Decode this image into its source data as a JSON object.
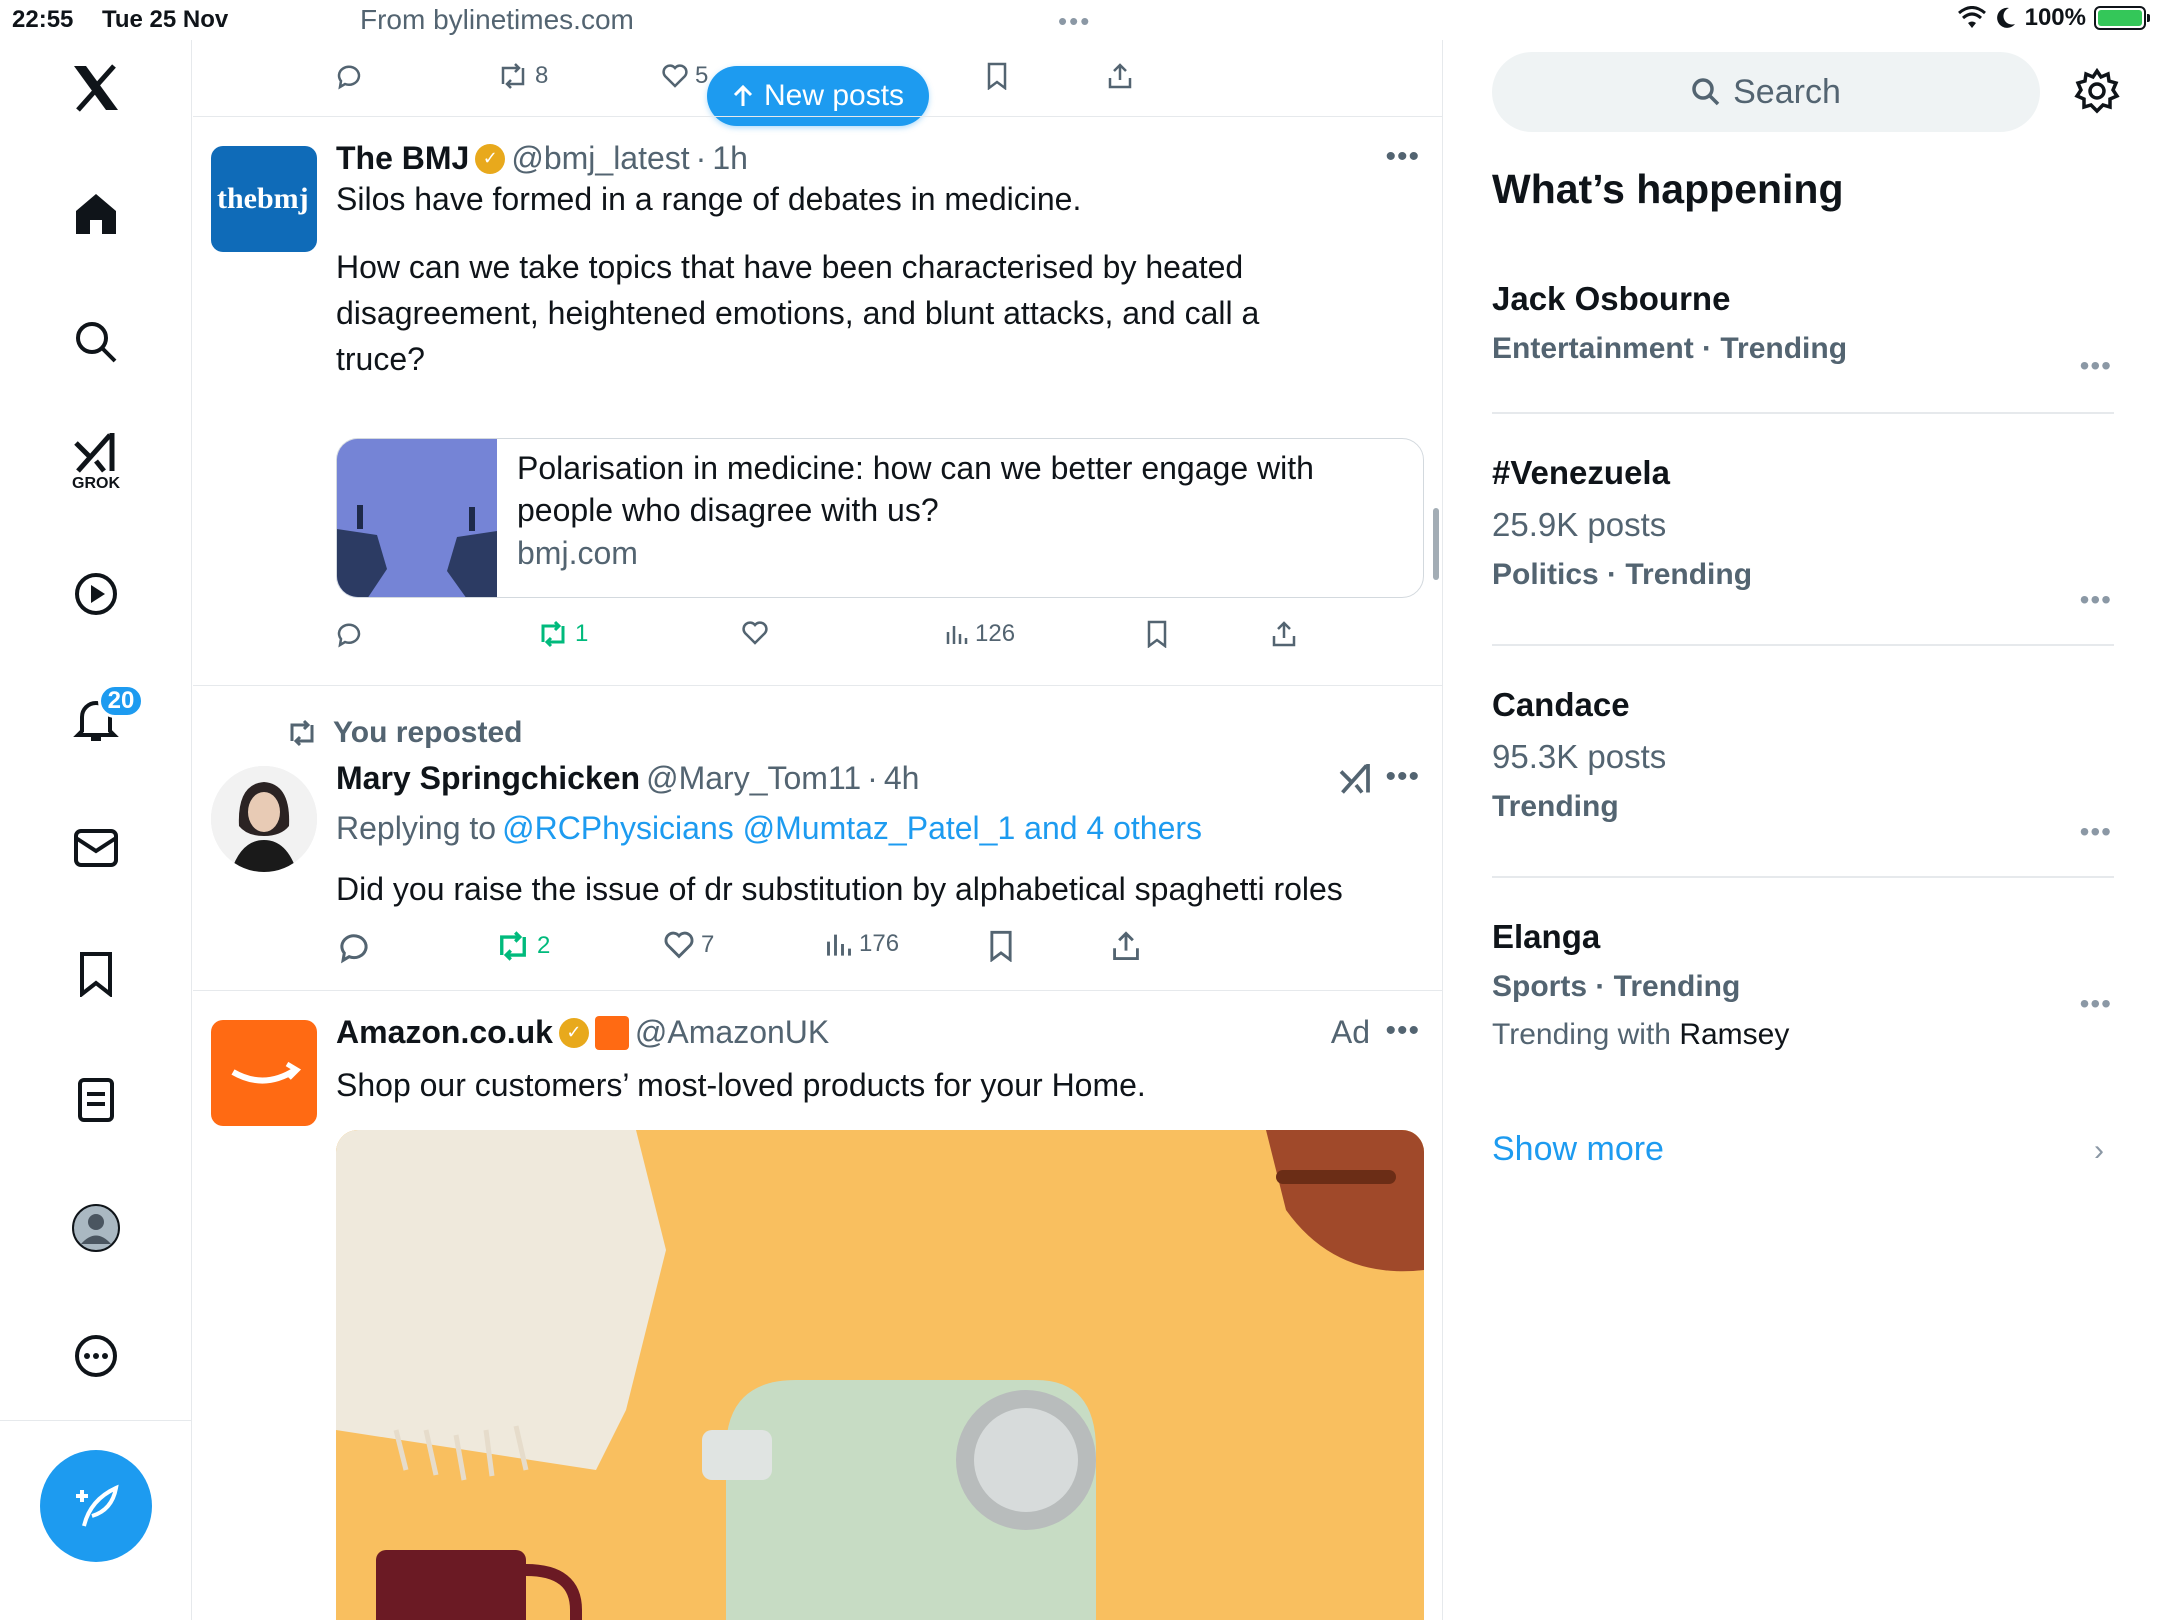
{
  "status": {
    "time": "22:55",
    "date": "Tue 25 Nov",
    "url": "From bylinetimes.com",
    "battery": "100%"
  },
  "nav": {
    "notifications_badge": "20",
    "grok_label": "GROK"
  },
  "feed": {
    "new_posts_label": "New posts",
    "top_actions": {
      "retweets": "8",
      "likes": "5"
    },
    "post1": {
      "avatar_text": "thebmj",
      "name": "The BMJ",
      "handle": "@bmj_latest",
      "time": "1h",
      "text_line1": "Silos have formed in a range of debates in medicine.",
      "text_para2": "How can we take topics that have been characterised by heated disagreement, heightened emotions, and blunt attacks, and call a truce?",
      "card_title": "Polarisation in medicine: how can we better engage with people who disagree with us?",
      "card_domain": "bmj.com",
      "retweets": "1",
      "views": "126"
    },
    "post2": {
      "repost_label": "You reposted",
      "name": "Mary Springchicken",
      "handle": "@Mary_Tom11",
      "time": "4h",
      "replying_prefix": "Replying to",
      "replying_to": "@RCPhysicians @Mumtaz_Patel_1 and 4 others",
      "text": "Did you raise the issue of dr substitution by alphabetical spaghetti roles",
      "retweets": "2",
      "likes": "7",
      "views": "176"
    },
    "post3": {
      "name": "Amazon.co.uk",
      "handle": "@AmazonUK",
      "ad_label": "Ad",
      "text": "Shop our customers’ most-loved products for your Home."
    }
  },
  "right": {
    "search_placeholder": "Search",
    "whats_happening": "What’s happening",
    "trends": [
      {
        "name": "Jack Osbourne",
        "posts": "",
        "category": "Entertainment · Trending"
      },
      {
        "name": "#Venezuela",
        "posts": "25.9K posts",
        "category": "Politics · Trending"
      },
      {
        "name": "Candace",
        "posts": "95.3K posts",
        "category": "Trending"
      },
      {
        "name": "Elanga",
        "posts": "",
        "category": "Sports · Trending",
        "with_prefix": "Trending with",
        "with_name": "Ramsey"
      }
    ],
    "show_more": "Show more"
  },
  "colors": {
    "accent": "#1d9bf0",
    "repost_green": "#00ba7c",
    "bmj_blue": "#0f6bb8",
    "amazon_orange": "#ff6a13",
    "verified_gold": "#e8a91c"
  }
}
